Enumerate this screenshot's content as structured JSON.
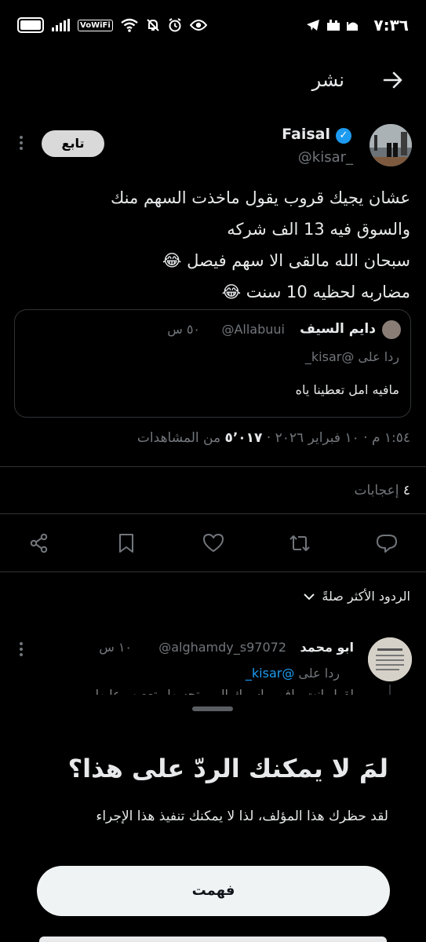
{
  "status_bar": {
    "time": "٧:٣٦",
    "vowifi": "VoWiFi"
  },
  "header": {
    "title": "نشر"
  },
  "tweet": {
    "name": "Faisal",
    "handle": "@kisar_",
    "follow_label": "تابع",
    "lines": [
      "عشان يجيك قروب يقول ماخذت السهم منك",
      "والسوق فيه 13 الف شركه",
      "سبحان الله مالقى الا سهم فيصل 😂",
      "مضاربه لحظيه 10 سنت 😂"
    ],
    "quote": {
      "name": "دايم السيف",
      "handle": "@Allabuui",
      "time": "٥٠ س",
      "replying_to": "ردا على @kisar_",
      "text": "مافيه امل تعطينا ياه"
    },
    "timestamp": "١:٥٤ م · ١٠ فبراير ٢٠٢٦ · ",
    "views_count": "٥٬٠١٧",
    "views_label": " من المشاهدات",
    "likes_count": "٤",
    "likes_label": " إعجابات"
  },
  "replies_sort": {
    "label": "الردود الأكثر صلةً"
  },
  "reply": {
    "name": "ابو محمد",
    "handle": "@alghamdy_s97072",
    "time": "١٠ س",
    "replying_prefix": "ردا على ",
    "replying_mention": "@kisar_",
    "text": "لقول انت واف، واسمك ال... تحسها وتعصب عليها"
  },
  "sheet": {
    "title": "لمَ لا يمكنك الردّ على هذا؟",
    "subtitle": "لقد حظرك هذا المؤلف، لذا لا يمكنك تنفيذ هذا الإجراء",
    "button_label": "فهمت"
  }
}
